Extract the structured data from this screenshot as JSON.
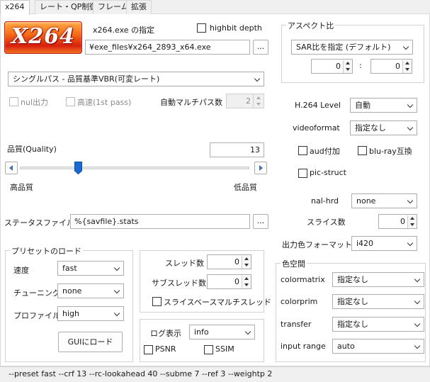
{
  "tabs": [
    "x264",
    "レート・QP制御",
    "フレーム",
    "拡張"
  ],
  "logo_text": "X264",
  "exe_label": "x264.exe の指定",
  "exe_path": "¥exe_files¥x264_2893_x64.exe",
  "browse_label": "...",
  "highbit_label": "highbit depth",
  "mode_select": "シングルパス - 品質基準VBR(可変レート)",
  "nul_output_label": "nul出力",
  "fast_first_pass_label": "高速(1st pass)",
  "auto_multipass_label": "自動マルチパス数",
  "auto_multipass_value": "2",
  "quality": {
    "label": "品質(Quality)",
    "value": "13",
    "low_label": "高品質",
    "high_label": "低品質",
    "slider_min": 0,
    "slider_max": 51,
    "slider_value": 13
  },
  "stats_label": "ステータスファイル",
  "stats_value": "%{savfile}.stats",
  "aspect": {
    "title": "アスペクト比",
    "select": "SAR比を指定 (デフォルト)",
    "x": "0",
    "separator": ":",
    "y": "0"
  },
  "h264_level_label": "H.264 Level",
  "h264_level_value": "自動",
  "videoformat_label": "videoformat",
  "videoformat_value": "指定なし",
  "aud_label": "aud付加",
  "bluray_label": "blu-ray互換",
  "picstruct_label": "pic-struct",
  "nalhrd_label": "nal-hrd",
  "nalhrd_value": "none",
  "slices_label": "スライス数",
  "slices_value": "0",
  "output_color_label": "出力色フォーマット",
  "output_color_value": "i420",
  "preset": {
    "title": "プリセットのロード",
    "speed_label": "速度",
    "speed_value": "fast",
    "tune_label": "チューニング",
    "tune_value": "none",
    "profile_label": "プロファイル",
    "profile_value": "high",
    "load_button": "GUIにロード"
  },
  "threads": {
    "threads_label": "スレッド数",
    "threads_value": "0",
    "subthreads_label": "サブスレッド数",
    "subthreads_value": "0",
    "slice_multi_label": "スライスベースマルチスレッド"
  },
  "log": {
    "label": "ログ表示",
    "value": "info",
    "psnr_label": "PSNR",
    "ssim_label": "SSIM"
  },
  "colorspace": {
    "title": "色空間",
    "matrix_label": "colormatrix",
    "matrix_value": "指定なし",
    "prim_label": "colorprim",
    "prim_value": "指定なし",
    "transfer_label": "transfer",
    "transfer_value": "指定なし",
    "range_label": "input range",
    "range_value": "auto"
  },
  "statusbar": "--preset fast --crf 13 --rc-lookahead 40 --subme 7 --ref 3 --weightp 2"
}
